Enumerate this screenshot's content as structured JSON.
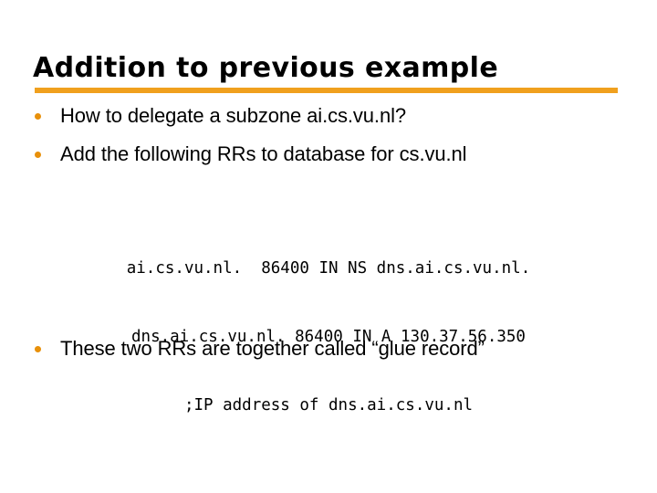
{
  "slide": {
    "title": "Addition to previous example",
    "accent_color": "#F0A01E",
    "bullet_color": "#E8900A",
    "background_color": "#FFFFFF",
    "text_color": "#000000",
    "bullets_top": [
      {
        "text": "How to delegate a subzone ai.cs.vu.nl?"
      },
      {
        "text": "Add the following RRs to database for cs.vu.nl"
      }
    ],
    "code_block": {
      "lines": [
        "ai.cs.vu.nl.  86400 IN NS dns.ai.cs.vu.nl.",
        "dns.ai.cs.vu.nl. 86400 IN A 130.37.56.350",
        ";IP address of dns.ai.cs.vu.nl"
      ]
    },
    "bullets_bottom": [
      {
        "text": "These two RRs are together called “glue record”"
      }
    ]
  }
}
